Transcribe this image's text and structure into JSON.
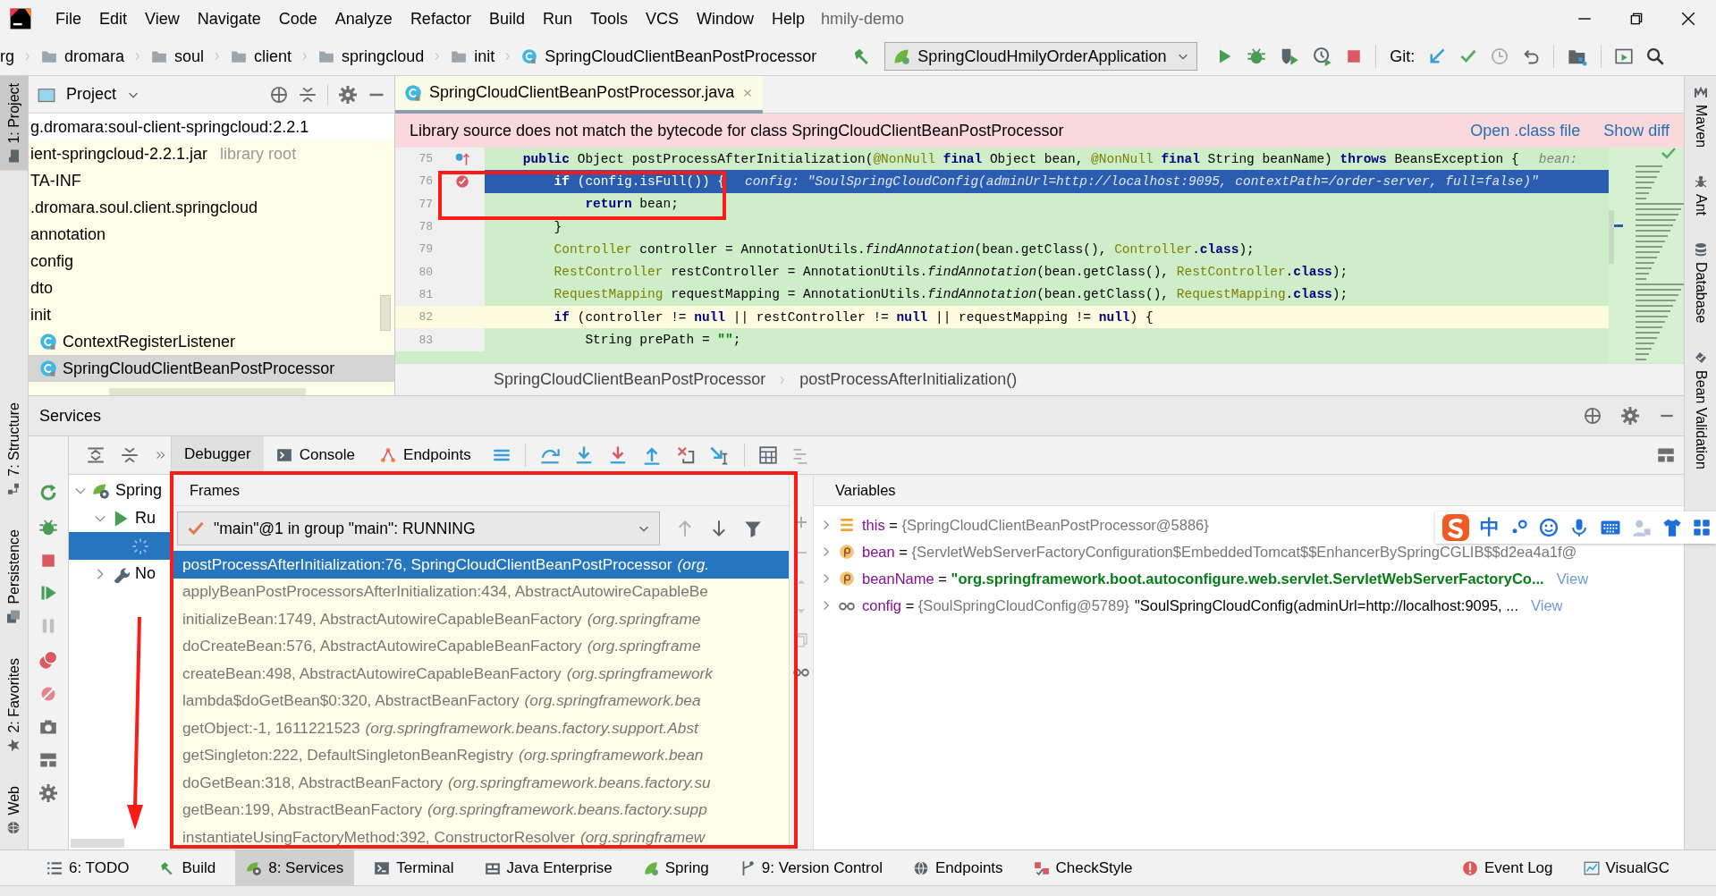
{
  "menu_bar": {
    "items": [
      "File",
      "Edit",
      "View",
      "Navigate",
      "Code",
      "Analyze",
      "Refactor",
      "Build",
      "Run",
      "Tools",
      "VCS",
      "Window",
      "Help"
    ],
    "project_title": "hmily-demo"
  },
  "nav_bar": {
    "breadcrumbs": [
      {
        "label": "rg",
        "kind": "text"
      },
      {
        "label": "dromara",
        "kind": "folder"
      },
      {
        "label": "soul",
        "kind": "folder"
      },
      {
        "label": "client",
        "kind": "folder"
      },
      {
        "label": "springcloud",
        "kind": "folder"
      },
      {
        "label": "init",
        "kind": "folder"
      },
      {
        "label": "SpringCloudClientBeanPostProcessor",
        "kind": "class"
      }
    ],
    "run_config": "SpringCloudHmilyOrderApplication",
    "git_label": "Git:"
  },
  "left_stripe": [
    {
      "label": "1: Project",
      "kind": "project",
      "selected": true
    },
    {
      "label": "7: Structure",
      "kind": "structure",
      "selected": false
    },
    {
      "label": "Persistence",
      "kind": "persistence",
      "selected": false
    },
    {
      "label": "2: Favorites",
      "kind": "favorites",
      "selected": false
    },
    {
      "label": "Web",
      "kind": "web",
      "selected": false
    }
  ],
  "right_stripe": [
    {
      "label": "Maven",
      "kind": "maven"
    },
    {
      "label": "Ant",
      "kind": "ant"
    },
    {
      "label": "Database",
      "kind": "database"
    },
    {
      "label": "Bean Validation",
      "kind": "validation"
    }
  ],
  "project_panel": {
    "title": "Project",
    "items": [
      {
        "label": "g.dromara:soul-client-springcloud:2.2.1",
        "kind": "module",
        "selected": false
      },
      {
        "label": "ient-springcloud-2.2.1.jar",
        "note": "library root",
        "kind": "text",
        "selected": false
      },
      {
        "label": "TA-INF",
        "kind": "text",
        "selected": false
      },
      {
        "label": ".dromara.soul.client.springcloud",
        "kind": "text",
        "selected": false
      },
      {
        "label": "annotation",
        "kind": "text",
        "selected": false
      },
      {
        "label": "config",
        "kind": "text",
        "selected": false
      },
      {
        "label": "dto",
        "kind": "text",
        "selected": false
      },
      {
        "label": "init",
        "kind": "text",
        "selected": false
      },
      {
        "label": "ContextRegisterListener",
        "kind": "class",
        "selected": false
      },
      {
        "label": "SpringCloudClientBeanPostProcessor",
        "kind": "class",
        "selected": true
      }
    ]
  },
  "editor": {
    "tabs": [
      {
        "label": "SpringCloudClientBeanPostProcessor.java",
        "selected": true
      }
    ],
    "banner": {
      "message": "Library source does not match the bytecode for class SpringCloudClientBeanPostProcessor",
      "links": [
        "Open .class file",
        "Show diff"
      ]
    },
    "lines": [
      {
        "number": "75",
        "execution_point": false,
        "caret_line": false,
        "breakpoint": false,
        "override_marker": true,
        "segments": [
          {
            "text": "    public ",
            "kind": "kw"
          },
          {
            "text": "Object postProcessAfterInitialization(",
            "kind": "plain"
          },
          {
            "text": "@NonNull ",
            "kind": "ann"
          },
          {
            "text": "final ",
            "kind": "kw"
          },
          {
            "text": "Object bean, ",
            "kind": "plain"
          },
          {
            "text": "@NonNull ",
            "kind": "ann"
          },
          {
            "text": "final ",
            "kind": "kw"
          },
          {
            "text": "String beanName) ",
            "kind": "plain"
          },
          {
            "text": "throws ",
            "kind": "kw"
          },
          {
            "text": "BeansException {",
            "kind": "plain"
          }
        ],
        "hint": "bean:"
      },
      {
        "number": "76",
        "execution_point": true,
        "caret_line": false,
        "breakpoint": true,
        "override_marker": false,
        "segments": [
          {
            "text": "        if ",
            "kind": "kw"
          },
          {
            "text": "(config.isFull()) {",
            "kind": "plain"
          }
        ],
        "hint": "config: \"SoulSpringCloudConfig(adminUrl=http://localhost:9095, contextPath=/order-server, full=false)\""
      },
      {
        "number": "77",
        "execution_point": false,
        "caret_line": false,
        "breakpoint": false,
        "override_marker": false,
        "segments": [
          {
            "text": "            return ",
            "kind": "kw"
          },
          {
            "text": "bean;",
            "kind": "plain"
          }
        ]
      },
      {
        "number": "78",
        "execution_point": false,
        "caret_line": false,
        "breakpoint": false,
        "override_marker": false,
        "segments": [
          {
            "text": "        }",
            "kind": "plain"
          }
        ]
      },
      {
        "number": "79",
        "execution_point": false,
        "caret_line": false,
        "breakpoint": false,
        "override_marker": false,
        "segments": [
          {
            "text": "        Controller ",
            "kind": "type"
          },
          {
            "text": "controller = AnnotationUtils.",
            "kind": "plain"
          },
          {
            "text": "findAnnotation",
            "kind": "call"
          },
          {
            "text": "(bean.getClass(), ",
            "kind": "plain"
          },
          {
            "text": "Controller",
            "kind": "type"
          },
          {
            "text": ".",
            "kind": "plain"
          },
          {
            "text": "class",
            "kind": "kw"
          },
          {
            "text": ");",
            "kind": "plain"
          }
        ]
      },
      {
        "number": "80",
        "execution_point": false,
        "caret_line": false,
        "breakpoint": false,
        "override_marker": false,
        "segments": [
          {
            "text": "        RestController ",
            "kind": "type"
          },
          {
            "text": "restController = AnnotationUtils.",
            "kind": "plain"
          },
          {
            "text": "findAnnotation",
            "kind": "call"
          },
          {
            "text": "(bean.getClass(), ",
            "kind": "plain"
          },
          {
            "text": "RestController",
            "kind": "type"
          },
          {
            "text": ".",
            "kind": "plain"
          },
          {
            "text": "class",
            "kind": "kw"
          },
          {
            "text": ");",
            "kind": "plain"
          }
        ]
      },
      {
        "number": "81",
        "execution_point": false,
        "caret_line": false,
        "breakpoint": false,
        "override_marker": false,
        "segments": [
          {
            "text": "        RequestMapping ",
            "kind": "type"
          },
          {
            "text": "requestMapping = AnnotationUtils.",
            "kind": "plain"
          },
          {
            "text": "findAnnotation",
            "kind": "call"
          },
          {
            "text": "(bean.getClass(), ",
            "kind": "plain"
          },
          {
            "text": "RequestMapping",
            "kind": "type"
          },
          {
            "text": ".",
            "kind": "plain"
          },
          {
            "text": "class",
            "kind": "kw"
          },
          {
            "text": ");",
            "kind": "plain"
          }
        ]
      },
      {
        "number": "82",
        "execution_point": false,
        "caret_line": true,
        "breakpoint": false,
        "override_marker": false,
        "segments": [
          {
            "text": "        if ",
            "kind": "kw"
          },
          {
            "text": "(controller != ",
            "kind": "plain"
          },
          {
            "text": "null",
            "kind": "kw"
          },
          {
            "text": " || restController != ",
            "kind": "plain"
          },
          {
            "text": "null",
            "kind": "kw"
          },
          {
            "text": " || requestMapping != ",
            "kind": "plain"
          },
          {
            "text": "null",
            "kind": "kw"
          },
          {
            "text": ") {",
            "kind": "plain"
          }
        ]
      },
      {
        "number": "83",
        "execution_point": false,
        "caret_line": false,
        "breakpoint": false,
        "override_marker": false,
        "segments": [
          {
            "text": "            String prePath = ",
            "kind": "plain"
          },
          {
            "text": "\"\"",
            "kind": "str"
          },
          {
            "text": ";",
            "kind": "plain"
          }
        ]
      }
    ],
    "breadcrumbs": [
      "SpringCloudClientBeanPostProcessor",
      "postProcessAfterInitialization()"
    ]
  },
  "services": {
    "title": "Services",
    "tree": [
      {
        "label": "Spring",
        "kind": "spring",
        "expanded": true,
        "selected": false,
        "children": [
          {
            "label": "Ru",
            "kind": "run",
            "expanded": true,
            "selected": false,
            "children": [
              {
                "kind": "loading",
                "selected": true
              }
            ]
          },
          {
            "label": "No",
            "kind": "tool",
            "expanded": false,
            "selected": false
          }
        ]
      }
    ],
    "debugger_tabs": [
      {
        "label": "Debugger",
        "kind": "debugger",
        "selected": true
      },
      {
        "label": "Console",
        "kind": "console",
        "selected": false
      },
      {
        "label": "Endpoints",
        "kind": "endpoints",
        "selected": false
      }
    ],
    "frames": {
      "title": "Frames",
      "thread": "\"main\"@1 in group \"main\": RUNNING",
      "items": [
        {
          "method": "postProcessAfterInitialization:76, SpringCloudClientBeanPostProcessor",
          "package": "(org.",
          "selected": true
        },
        {
          "method": "applyBeanPostProcessorsAfterInitialization:434, AbstractAutowireCapableBe",
          "selected": false
        },
        {
          "method": "initializeBean:1749, AbstractAutowireCapableBeanFactory",
          "package": "(org.springframe",
          "selected": false
        },
        {
          "method": "doCreateBean:576, AbstractAutowireCapableBeanFactory",
          "package": "(org.springframe",
          "selected": false
        },
        {
          "method": "createBean:498, AbstractAutowireCapableBeanFactory",
          "package": "(org.springframework",
          "selected": false
        },
        {
          "method": "lambda$doGetBean$0:320, AbstractBeanFactory",
          "package": "(org.springframework.bea",
          "selected": false
        },
        {
          "method": "getObject:-1, 1611221523",
          "package": "(org.springframework.beans.factory.support.Abst",
          "selected": false
        },
        {
          "method": "getSingleton:222, DefaultSingletonBeanRegistry",
          "package": "(org.springframework.bean",
          "selected": false
        },
        {
          "method": "doGetBean:318, AbstractBeanFactory",
          "package": "(org.springframework.beans.factory.su",
          "selected": false
        },
        {
          "method": "getBean:199, AbstractBeanFactory",
          "package": "(org.springframework.beans.factory.supp",
          "selected": false
        },
        {
          "method": "instantiateUsingFactoryMethod:392, ConstructorResolver",
          "package": "(org.springframew",
          "selected": false
        }
      ]
    },
    "variables": {
      "title": "Variables",
      "items": [
        {
          "kind": "field",
          "name": "this",
          "operator": "=",
          "value": "{SpringCloudClientBeanPostProcessor@5886}",
          "string_value": false
        },
        {
          "kind": "param",
          "name": "bean",
          "operator": "=",
          "value": "{ServletWebServerFactoryConfiguration$EmbeddedTomcat$$EnhancerBySpringCGLIB$$d2ea4a1f@",
          "string_value": false
        },
        {
          "kind": "param",
          "name": "beanName",
          "operator": "=",
          "value": "\"org.springframework.boot.autoconfigure.web.servlet.ServletWebServerFactoryCo...",
          "string_value": true,
          "link": "View"
        },
        {
          "kind": "watch",
          "name": "config",
          "operator": "=",
          "value": "{SoulSpringCloudConfig@5789}",
          "detail": "\"SoulSpringCloudConfig(adminUrl=http://localhost:9095, ...",
          "string_value": false,
          "link": "View"
        }
      ]
    }
  },
  "ime_toolbar": {
    "label": "中"
  },
  "bottom_bar": {
    "tools": [
      {
        "label": "6: TODO",
        "kind": "todo",
        "selected": false
      },
      {
        "label": "Build",
        "kind": "build",
        "selected": false
      },
      {
        "label": "8: Services",
        "kind": "services",
        "selected": true
      },
      {
        "label": "Terminal",
        "kind": "terminal",
        "selected": false
      },
      {
        "label": "Java Enterprise",
        "kind": "javaee",
        "selected": false
      },
      {
        "label": "Spring",
        "kind": "spring",
        "selected": false
      },
      {
        "label": "9: Version Control",
        "kind": "vcs",
        "selected": false
      },
      {
        "label": "Endpoints",
        "kind": "endpoints",
        "selected": false
      },
      {
        "label": "CheckStyle",
        "kind": "checkstyle",
        "selected": false
      }
    ],
    "right_tools": [
      {
        "label": "Event Log",
        "kind": "eventlog"
      },
      {
        "label": "VisualGC",
        "kind": "visualgc"
      }
    ]
  },
  "annotations": [
    {
      "kind": "box"
    },
    {
      "kind": "box"
    },
    {
      "kind": "arrow"
    }
  ]
}
